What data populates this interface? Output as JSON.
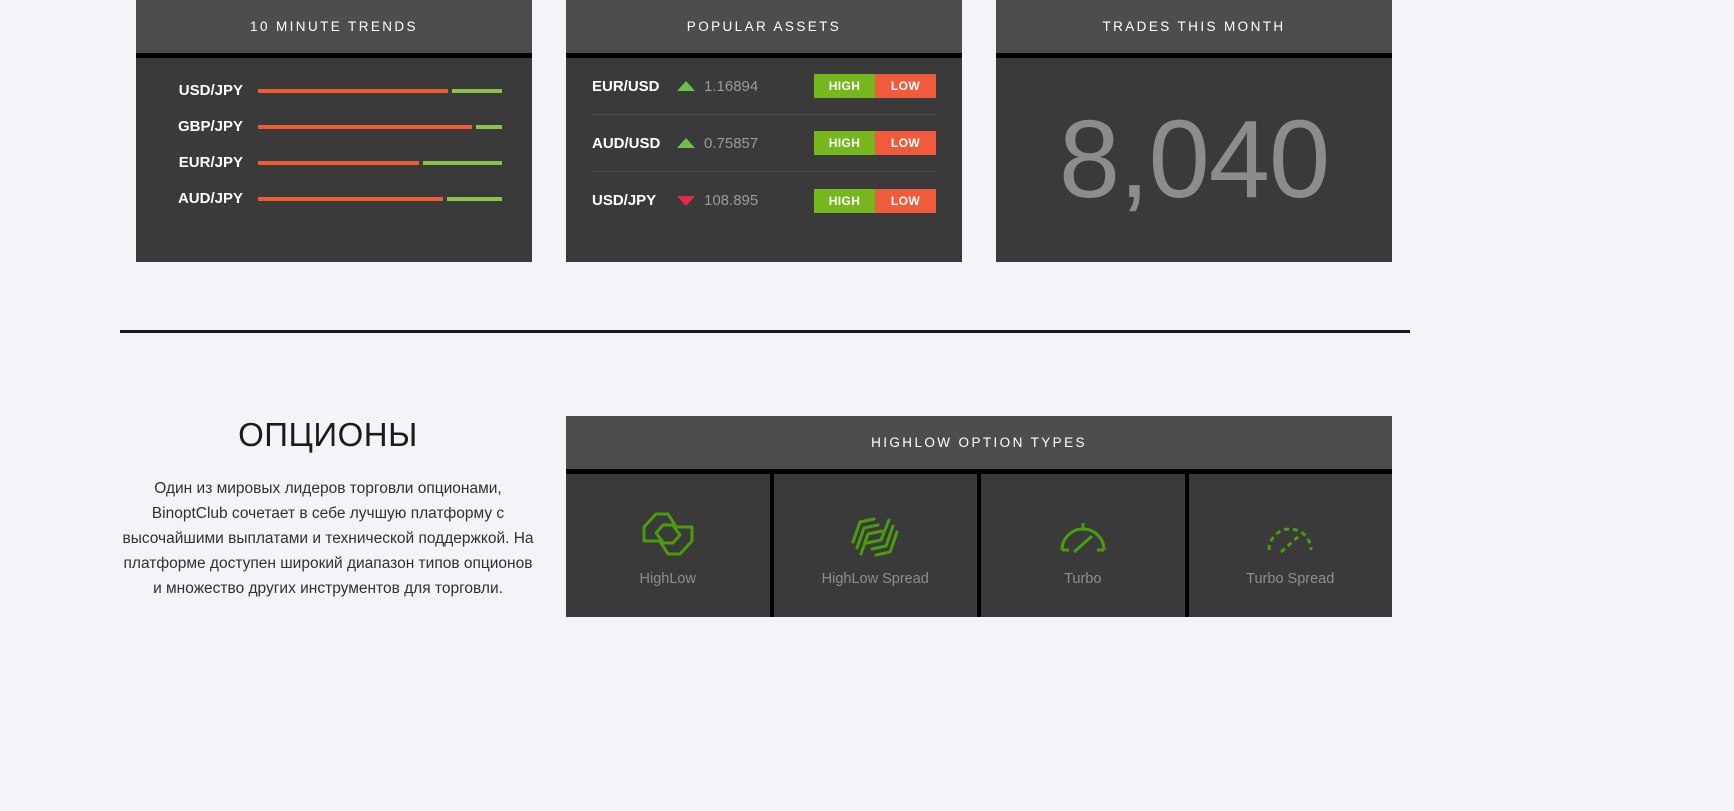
{
  "colors": {
    "card_bg": "#3a3a3a",
    "card_header_bg": "#4d4d4d",
    "page_bg": "#f4f4f8",
    "down_red": "#ef5b33",
    "up_green": "#8bc34a",
    "high_green": "#76b71e",
    "low_red": "#ef5b3c",
    "arrow_up": "#6fbf4b",
    "arrow_down": "#e8274b",
    "option_icon_green": "#4b9b0e",
    "trades_number": "#8c8c8c"
  },
  "trends_card": {
    "title": "10 MINUTE TRENDS",
    "rows": [
      {
        "label": "USD/JPY",
        "down_pct": 79,
        "up_pct": 21
      },
      {
        "label": "GBP/JPY",
        "down_pct": 89,
        "up_pct": 11
      },
      {
        "label": "EUR/JPY",
        "down_pct": 67,
        "up_pct": 33
      },
      {
        "label": "AUD/JPY",
        "down_pct": 77,
        "up_pct": 23
      }
    ]
  },
  "assets_card": {
    "title": "POPULAR ASSETS",
    "high_label": "HIGH",
    "low_label": "LOW",
    "rows": [
      {
        "pair": "EUR/USD",
        "direction": "up",
        "price": "1.16894"
      },
      {
        "pair": "AUD/USD",
        "direction": "up",
        "price": "0.75857"
      },
      {
        "pair": "USD/JPY",
        "direction": "down",
        "price": "108.895"
      }
    ]
  },
  "trades_card": {
    "title": "TRADES THIS MONTH",
    "value": "8,040"
  },
  "intro": {
    "heading": "ОПЦИОНЫ",
    "paragraph": "Один из мировых лидеров торговли опционами, BinoptClub сочетает в себе лучшую платформу с высочайшими выплатами и технической поддержкой. На платформе доступен широкий диапазон типов опционов и множество других инструментов для торговли."
  },
  "options_panel": {
    "title": "HIGHLOW OPTION TYPES",
    "items": [
      {
        "label": "HighLow",
        "icon": "highlow-icon"
      },
      {
        "label": "HighLow Spread",
        "icon": "highlow-spread-icon"
      },
      {
        "label": "Turbo",
        "icon": "turbo-gauge-icon"
      },
      {
        "label": "Turbo Spread",
        "icon": "turbo-spread-gauge-icon"
      }
    ]
  }
}
